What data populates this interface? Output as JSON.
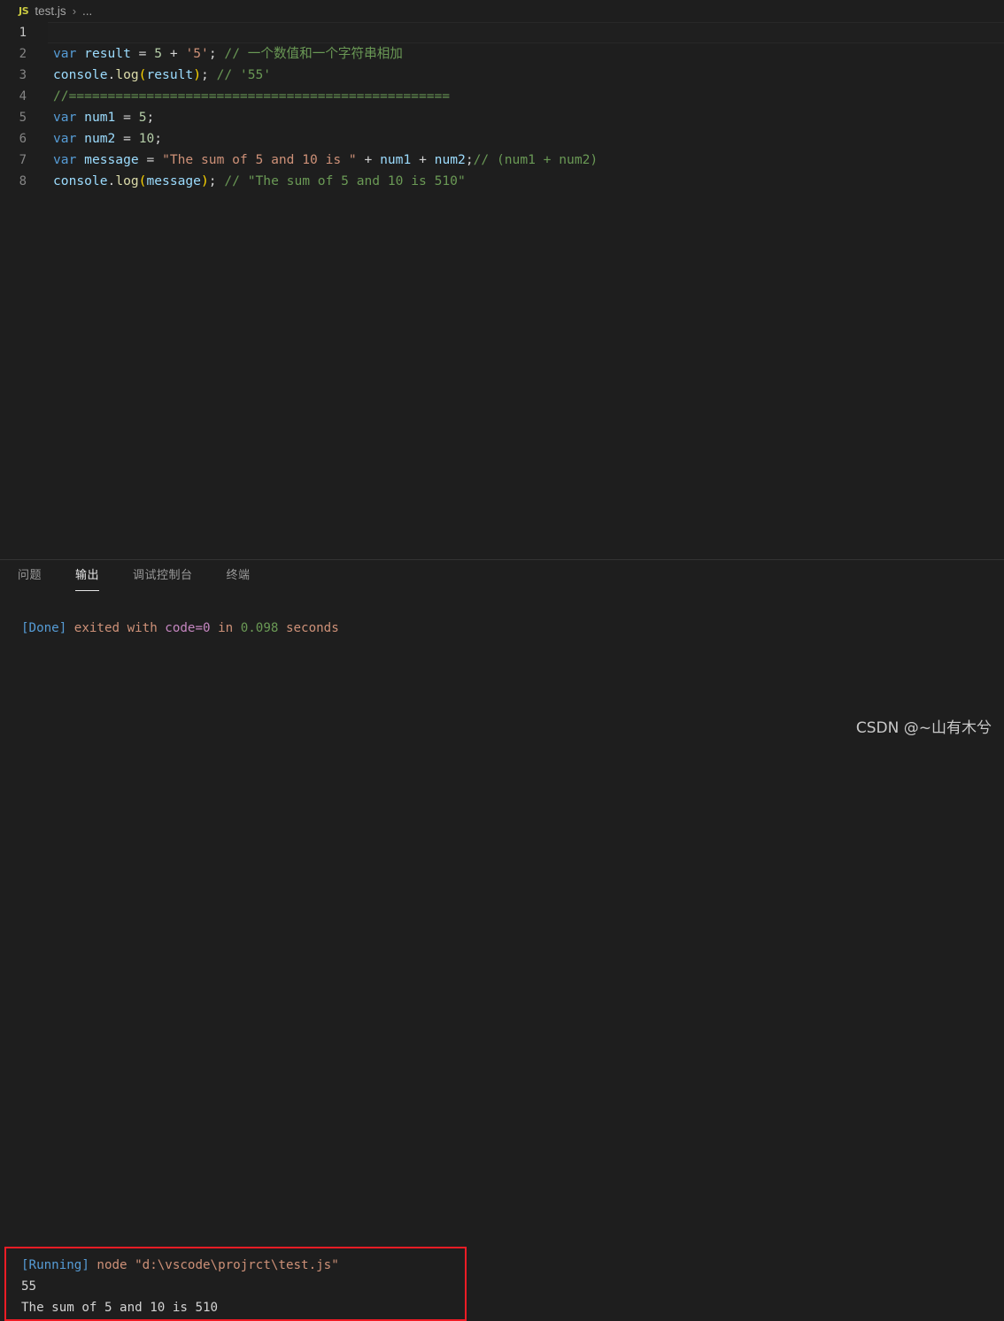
{
  "breadcrumb": {
    "file_icon": "JS",
    "file_name": "test.js",
    "separator": "›",
    "ellipsis": "..."
  },
  "editor": {
    "lines": [
      {
        "number": "1",
        "active": true,
        "tokens": []
      },
      {
        "number": "2",
        "active": false,
        "tokens": [
          {
            "cls": "t-key",
            "text": "var"
          },
          {
            "cls": "t-plain",
            "text": " "
          },
          {
            "cls": "t-var",
            "text": "result"
          },
          {
            "cls": "t-plain",
            "text": " "
          },
          {
            "cls": "t-op",
            "text": "="
          },
          {
            "cls": "t-plain",
            "text": " "
          },
          {
            "cls": "t-num",
            "text": "5"
          },
          {
            "cls": "t-plain",
            "text": " "
          },
          {
            "cls": "t-op",
            "text": "+"
          },
          {
            "cls": "t-plain",
            "text": " "
          },
          {
            "cls": "t-str",
            "text": "'5'"
          },
          {
            "cls": "t-plain",
            "text": ";"
          },
          {
            "cls": "t-plain",
            "text": " "
          },
          {
            "cls": "t-com",
            "text": "// 一个数值和一个字符串相加"
          }
        ]
      },
      {
        "number": "3",
        "active": false,
        "tokens": [
          {
            "cls": "t-var",
            "text": "console"
          },
          {
            "cls": "t-plain",
            "text": "."
          },
          {
            "cls": "t-fn",
            "text": "log"
          },
          {
            "cls": "t-paren",
            "text": "("
          },
          {
            "cls": "t-var",
            "text": "result"
          },
          {
            "cls": "t-paren",
            "text": ")"
          },
          {
            "cls": "t-plain",
            "text": ";"
          },
          {
            "cls": "t-plain",
            "text": " "
          },
          {
            "cls": "t-com",
            "text": "// '55'"
          }
        ]
      },
      {
        "number": "4",
        "active": false,
        "tokens": [
          {
            "cls": "t-com",
            "text": "//================================================="
          }
        ]
      },
      {
        "number": "5",
        "active": false,
        "tokens": [
          {
            "cls": "t-key",
            "text": "var"
          },
          {
            "cls": "t-plain",
            "text": " "
          },
          {
            "cls": "t-var",
            "text": "num1"
          },
          {
            "cls": "t-plain",
            "text": " "
          },
          {
            "cls": "t-op",
            "text": "="
          },
          {
            "cls": "t-plain",
            "text": " "
          },
          {
            "cls": "t-num",
            "text": "5"
          },
          {
            "cls": "t-plain",
            "text": ";"
          }
        ]
      },
      {
        "number": "6",
        "active": false,
        "tokens": [
          {
            "cls": "t-key",
            "text": "var"
          },
          {
            "cls": "t-plain",
            "text": " "
          },
          {
            "cls": "t-var",
            "text": "num2"
          },
          {
            "cls": "t-plain",
            "text": " "
          },
          {
            "cls": "t-op",
            "text": "="
          },
          {
            "cls": "t-plain",
            "text": " "
          },
          {
            "cls": "t-num",
            "text": "10"
          },
          {
            "cls": "t-plain",
            "text": ";"
          }
        ]
      },
      {
        "number": "7",
        "active": false,
        "tokens": [
          {
            "cls": "t-key",
            "text": "var"
          },
          {
            "cls": "t-plain",
            "text": " "
          },
          {
            "cls": "t-var",
            "text": "message"
          },
          {
            "cls": "t-plain",
            "text": " "
          },
          {
            "cls": "t-op",
            "text": "="
          },
          {
            "cls": "t-plain",
            "text": " "
          },
          {
            "cls": "t-str",
            "text": "\"The sum of 5 and 10 is \""
          },
          {
            "cls": "t-plain",
            "text": " "
          },
          {
            "cls": "t-op",
            "text": "+"
          },
          {
            "cls": "t-plain",
            "text": " "
          },
          {
            "cls": "t-var",
            "text": "num1"
          },
          {
            "cls": "t-plain",
            "text": " "
          },
          {
            "cls": "t-op",
            "text": "+"
          },
          {
            "cls": "t-plain",
            "text": " "
          },
          {
            "cls": "t-var",
            "text": "num2"
          },
          {
            "cls": "t-plain",
            "text": ";"
          },
          {
            "cls": "t-com",
            "text": "// (num1 + num2)"
          }
        ]
      },
      {
        "number": "8",
        "active": false,
        "tokens": [
          {
            "cls": "t-var",
            "text": "console"
          },
          {
            "cls": "t-plain",
            "text": "."
          },
          {
            "cls": "t-fn",
            "text": "log"
          },
          {
            "cls": "t-paren",
            "text": "("
          },
          {
            "cls": "t-var",
            "text": "message"
          },
          {
            "cls": "t-paren",
            "text": ")"
          },
          {
            "cls": "t-plain",
            "text": ";"
          },
          {
            "cls": "t-plain",
            "text": " "
          },
          {
            "cls": "t-com",
            "text": "// \"The sum of 5 and 10 is 510\""
          }
        ]
      }
    ]
  },
  "panel": {
    "tabs": [
      {
        "label": "问题",
        "active": false
      },
      {
        "label": "输出",
        "active": true
      },
      {
        "label": "调试控制台",
        "active": false
      },
      {
        "label": "终端",
        "active": false
      }
    ],
    "output_lines": [
      {
        "boxed": false,
        "segments": [
          {
            "cls": "o-done",
            "text": "[Done]"
          },
          {
            "cls": "o-text",
            "text": " exited with "
          },
          {
            "cls": "o-code",
            "text": "code=0"
          },
          {
            "cls": "o-text",
            "text": " in "
          },
          {
            "cls": "o-num",
            "text": "0.098"
          },
          {
            "cls": "o-text",
            "text": " seconds"
          }
        ]
      },
      {
        "boxed": true,
        "segments": [
          {
            "cls": "o-running",
            "text": "[Running]"
          },
          {
            "cls": "o-text",
            "text": " node \"d:\\vscode\\projrct\\test.js\""
          }
        ]
      },
      {
        "boxed": true,
        "segments": [
          {
            "cls": "o-white",
            "text": "55"
          }
        ]
      },
      {
        "boxed": true,
        "segments": [
          {
            "cls": "o-white",
            "text": "The sum of 5 and 10 is 510"
          }
        ]
      }
    ],
    "highlight_color": "#ee1c25"
  },
  "watermark": {
    "text": "CSDN @~山有木兮"
  }
}
